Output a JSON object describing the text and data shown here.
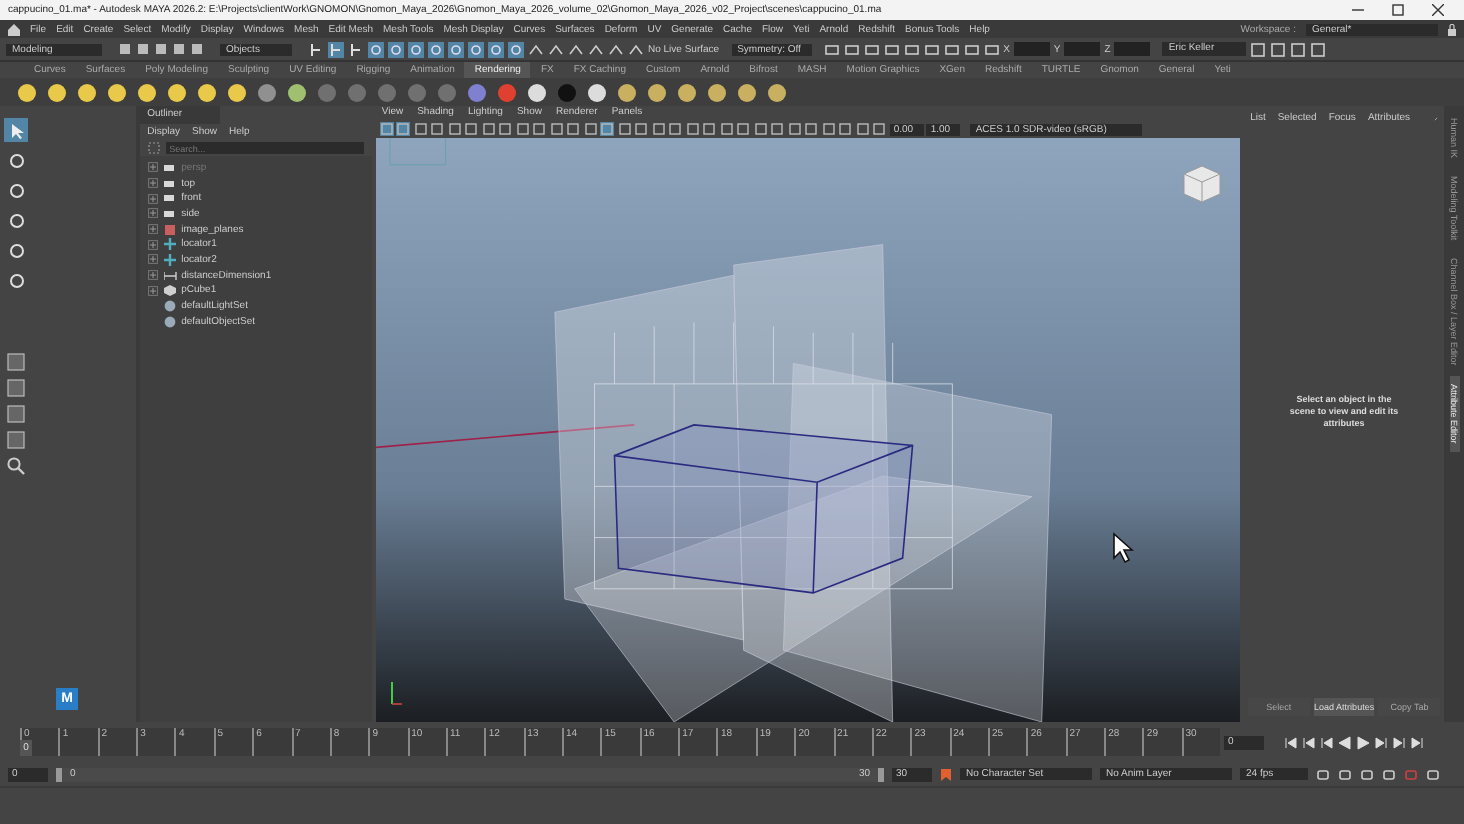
{
  "window": {
    "title": "cappucino_01.ma* - Autodesk MAYA 2026.2: E:\\Projects\\clientWork\\GNOMON\\Gnomon_Maya_2026\\Gnomon_Maya_2026_volume_02\\Gnomon_Maya_2026_v02_Project\\scenes\\cappucino_01.ma"
  },
  "menu_bar": [
    "File",
    "Edit",
    "Create",
    "Select",
    "Modify",
    "Display",
    "Windows",
    "Mesh",
    "Edit Mesh",
    "Mesh Tools",
    "Mesh Display",
    "Curves",
    "Surfaces",
    "Deform",
    "UV",
    "Generate",
    "Cache",
    "Flow",
    "Yeti",
    "Arnold",
    "Redshift",
    "Bonus Tools",
    "Help"
  ],
  "status_line": {
    "mode": "Modeling",
    "selection_mode": "Objects",
    "live_surface": "No Live Surface",
    "symmetry": "Symmetry: Off",
    "coord_labels": [
      "X",
      "Y",
      "Z"
    ],
    "user": "Eric Keller",
    "workspace_label": "Workspace :",
    "workspace": "General*"
  },
  "shelf": {
    "tabs": [
      {
        "label": "Curves",
        "selected": false
      },
      {
        "label": "Surfaces",
        "selected": false
      },
      {
        "label": "Poly Modeling",
        "selected": false
      },
      {
        "label": "Sculpting",
        "selected": false
      },
      {
        "label": "UV Editing",
        "selected": false
      },
      {
        "label": "Rigging",
        "selected": false
      },
      {
        "label": "Animation",
        "selected": false
      },
      {
        "label": "Rendering",
        "selected": true
      },
      {
        "label": "FX",
        "selected": false
      },
      {
        "label": "FX Caching",
        "selected": false
      },
      {
        "label": "Custom",
        "selected": false
      },
      {
        "label": "Arnold",
        "selected": false
      },
      {
        "label": "Bifrost",
        "selected": false
      },
      {
        "label": "MASH",
        "selected": false
      },
      {
        "label": "Motion Graphics",
        "selected": false
      },
      {
        "label": "XGen",
        "selected": false
      },
      {
        "label": "Redshift",
        "selected": false
      },
      {
        "label": "TURTLE",
        "selected": false
      },
      {
        "label": "Gnomon",
        "selected": false
      },
      {
        "label": "General",
        "selected": false
      },
      {
        "label": "Yeti",
        "selected": false
      }
    ]
  },
  "toolbox": {
    "tools": [
      {
        "selected": true
      },
      {
        "selected": false
      },
      {
        "selected": false
      },
      {
        "selected": false
      },
      {
        "selected": false
      },
      {
        "selected": false
      }
    ],
    "badge": "M"
  },
  "outliner": {
    "title": "Outliner",
    "menu": [
      "Display",
      "Show",
      "Help"
    ],
    "search": {
      "placeholder": "Search..."
    },
    "items": [
      {
        "label": "persp",
        "kind": "camera",
        "dimmed": true,
        "expandable": true
      },
      {
        "label": "top",
        "kind": "camera",
        "dimmed": false,
        "expandable": true
      },
      {
        "label": "front",
        "kind": "camera",
        "dimmed": false,
        "expandable": true
      },
      {
        "label": "side",
        "kind": "camera",
        "dimmed": false,
        "expandable": true
      },
      {
        "label": "image_planes",
        "kind": "image",
        "dimmed": false,
        "expandable": true
      },
      {
        "label": "locator1",
        "kind": "locator",
        "dimmed": false,
        "expandable": true
      },
      {
        "label": "locator2",
        "kind": "locator",
        "dimmed": false,
        "expandable": true
      },
      {
        "label": "distanceDimension1",
        "kind": "distance",
        "dimmed": false,
        "expandable": true
      },
      {
        "label": "pCube1",
        "kind": "mesh",
        "dimmed": false,
        "expandable": true
      },
      {
        "label": "defaultLightSet",
        "kind": "set",
        "dimmed": false,
        "expandable": false
      },
      {
        "label": "defaultObjectSet",
        "kind": "set",
        "dimmed": false,
        "expandable": false
      }
    ]
  },
  "viewport": {
    "menu": [
      "View",
      "Shading",
      "Lighting",
      "Show",
      "Renderer",
      "Panels"
    ],
    "exposure": "0.00",
    "gamma": "1.00",
    "color_space": "ACES 1.0 SDR-video (sRGB)"
  },
  "attribute_editor": {
    "tabs": [
      "List",
      "Selected",
      "Focus",
      "Attributes"
    ],
    "message": "Select an object in the scene to view and edit its attributes",
    "buttons": [
      {
        "label": "Select",
        "disabled": true
      },
      {
        "label": "Load Attributes",
        "disabled": false
      },
      {
        "label": "Copy Tab",
        "disabled": true
      }
    ]
  },
  "side_tabs": [
    {
      "label": "Human IK",
      "selected": false
    },
    {
      "label": "Modeling Toolkit",
      "selected": false
    },
    {
      "label": "Channel Box / Layer Editor",
      "selected": false
    },
    {
      "label": "Attribute Editor",
      "selected": true
    }
  ],
  "timeline": {
    "ticks": [
      "0",
      "1",
      "2",
      "3",
      "4",
      "5",
      "6",
      "7",
      "8",
      "9",
      "10",
      "11",
      "12",
      "13",
      "14",
      "15",
      "16",
      "17",
      "18",
      "19",
      "20",
      "21",
      "22",
      "23",
      "24",
      "25",
      "26",
      "27",
      "28",
      "29",
      "30"
    ],
    "current_frame": "0",
    "level": 0,
    "frame_field": "0"
  },
  "range": {
    "start": "0",
    "slider_start": "0",
    "slider_end": "30",
    "level": 1,
    "end": "30",
    "character_set": "No Character Set",
    "anim_layer": "No Anim Layer",
    "fps": "24 fps"
  }
}
